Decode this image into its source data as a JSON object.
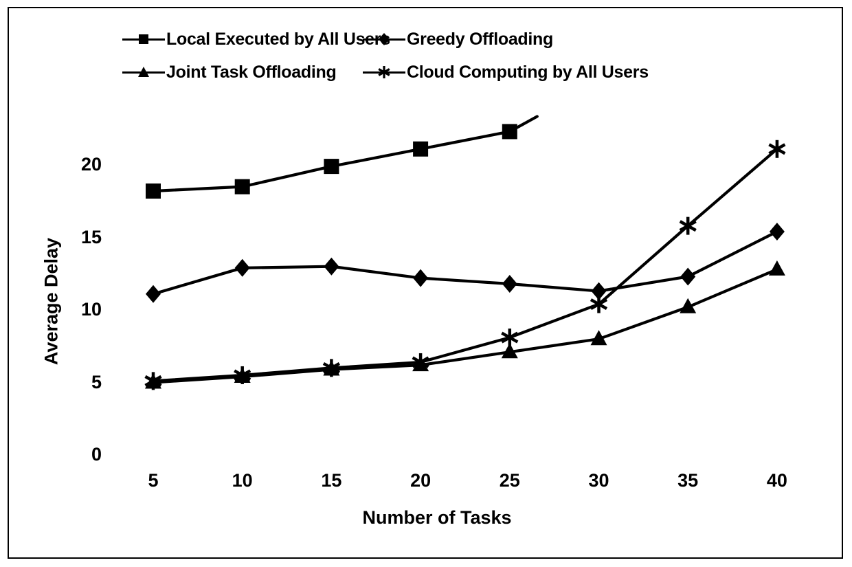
{
  "chart_data": {
    "type": "line",
    "title": "",
    "xlabel": "Number of Tasks",
    "ylabel": "Average Delay",
    "x": [
      5,
      10,
      15,
      20,
      25,
      30,
      35,
      40
    ],
    "xlim": [
      5,
      40
    ],
    "ylim": [
      0,
      23
    ],
    "xticks": [
      "5",
      "10",
      "15",
      "20",
      "25",
      "30",
      "35",
      "40"
    ],
    "yticks": [
      "0",
      "5",
      "10",
      "15",
      "20"
    ],
    "grid": false,
    "legend_position": "top",
    "series": [
      {
        "name": "Local Executed by All Users",
        "marker": "square",
        "x": [
          5,
          10,
          15,
          20,
          25
        ],
        "values": [
          18.2,
          18.5,
          19.9,
          21.1,
          22.3
        ]
      },
      {
        "name": "Greedy Offloading",
        "marker": "diamond",
        "x": [
          5,
          10,
          15,
          20,
          25,
          30,
          35,
          40
        ],
        "values": [
          11.1,
          12.9,
          13.0,
          12.2,
          11.8,
          11.3,
          12.3,
          15.4
        ]
      },
      {
        "name": "Joint Task Offloading",
        "marker": "triangle",
        "x": [
          5,
          10,
          15,
          20,
          25,
          30,
          35,
          40
        ],
        "values": [
          5.0,
          5.4,
          5.9,
          6.2,
          7.1,
          8.0,
          10.2,
          12.8
        ]
      },
      {
        "name": "Cloud Computing by All Users",
        "marker": "asterisk",
        "x": [
          5,
          10,
          15,
          20,
          25,
          30,
          35,
          40
        ],
        "values": [
          5.1,
          5.5,
          6.0,
          6.4,
          8.1,
          10.4,
          15.8,
          21.1
        ]
      }
    ]
  },
  "legend": {
    "rows": [
      [
        {
          "label": "Local Executed by All Users",
          "marker": "square"
        },
        {
          "label": "Greedy Offloading",
          "marker": "diamond"
        }
      ],
      [
        {
          "label": "Joint Task Offloading",
          "marker": "triangle"
        },
        {
          "label": "Cloud Computing by All Users",
          "marker": "asterisk"
        }
      ]
    ]
  },
  "colors": {
    "line": "#000000",
    "background": "#ffffff",
    "border": "#000000"
  }
}
